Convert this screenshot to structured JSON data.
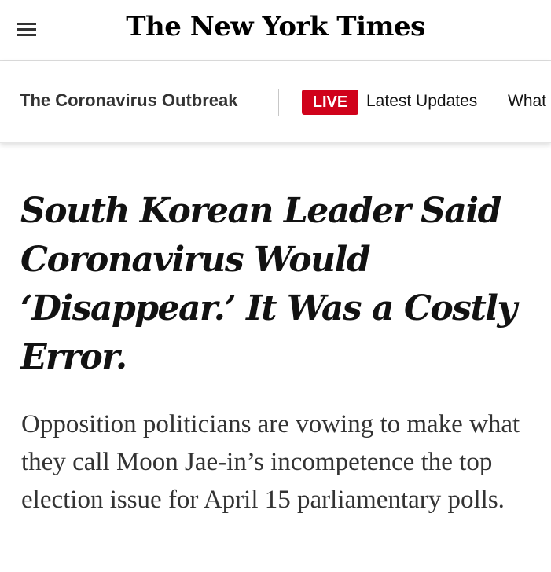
{
  "masthead": {
    "logo_text": "The New York Times",
    "menu_icon": "hamburger-menu-icon"
  },
  "subnav": {
    "section_title": "The Coronavirus Outbreak",
    "live_badge": "LIVE",
    "latest_updates": "Latest Updates",
    "next_link": "What"
  },
  "article": {
    "headline": "South Korean Leader Said Coronavirus Would ‘Disappear.’ It Was a Costly Error.",
    "summary": "Opposition politicians are vowing to make what they call Moon Jae-in’s incompetence the top election issue for April 15 parliamentary polls."
  },
  "colors": {
    "live_badge_bg": "#d0021b",
    "text": "#121212"
  }
}
